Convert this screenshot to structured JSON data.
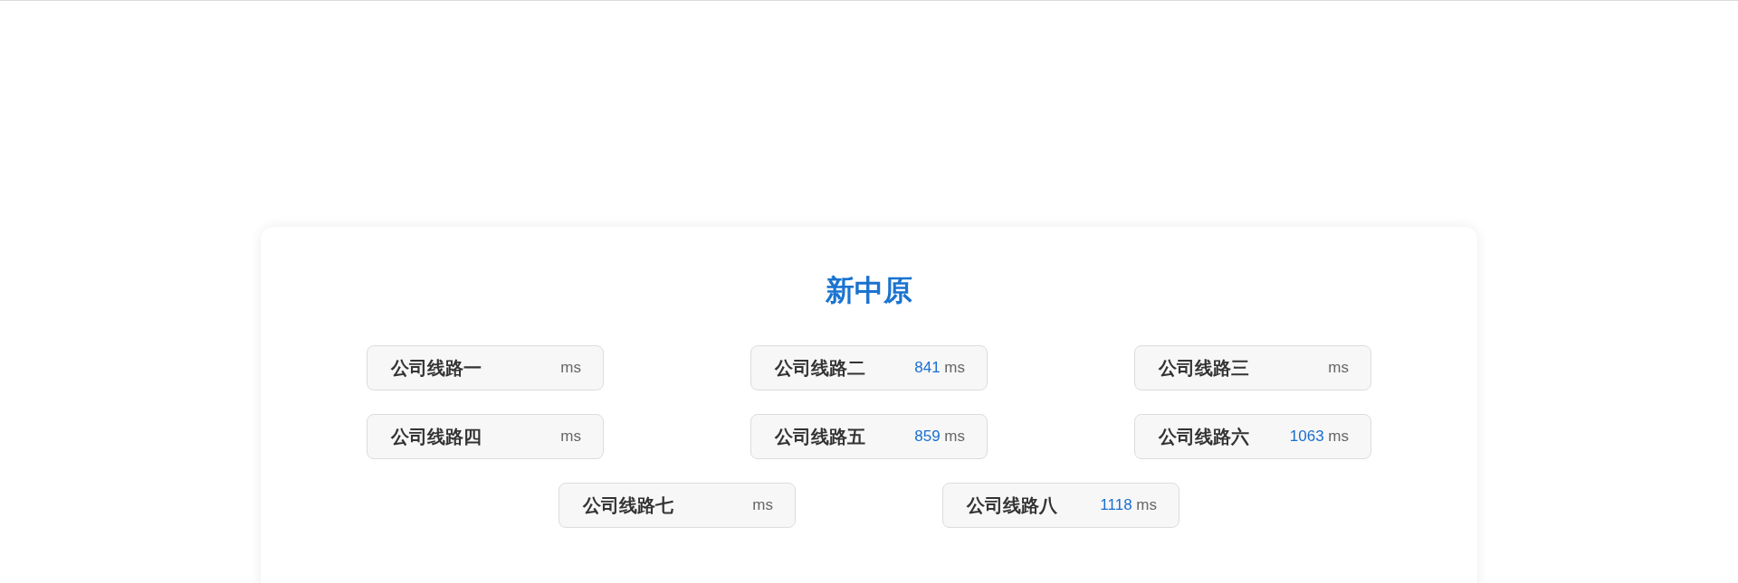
{
  "panel": {
    "title": "新中原",
    "lines": [
      {
        "name": "公司线路一",
        "unit": "ms"
      },
      {
        "name": "公司线路二",
        "latency": "841",
        "unit": "ms"
      },
      {
        "name": "公司线路三",
        "unit": "ms"
      },
      {
        "name": "公司线路四",
        "unit": "ms"
      },
      {
        "name": "公司线路五",
        "latency": "859",
        "unit": "ms"
      },
      {
        "name": "公司线路六",
        "latency": "1063",
        "unit": "ms"
      },
      {
        "name": "公司线路七",
        "unit": "ms"
      },
      {
        "name": "公司线路八",
        "latency": "1118",
        "unit": "ms"
      }
    ]
  }
}
